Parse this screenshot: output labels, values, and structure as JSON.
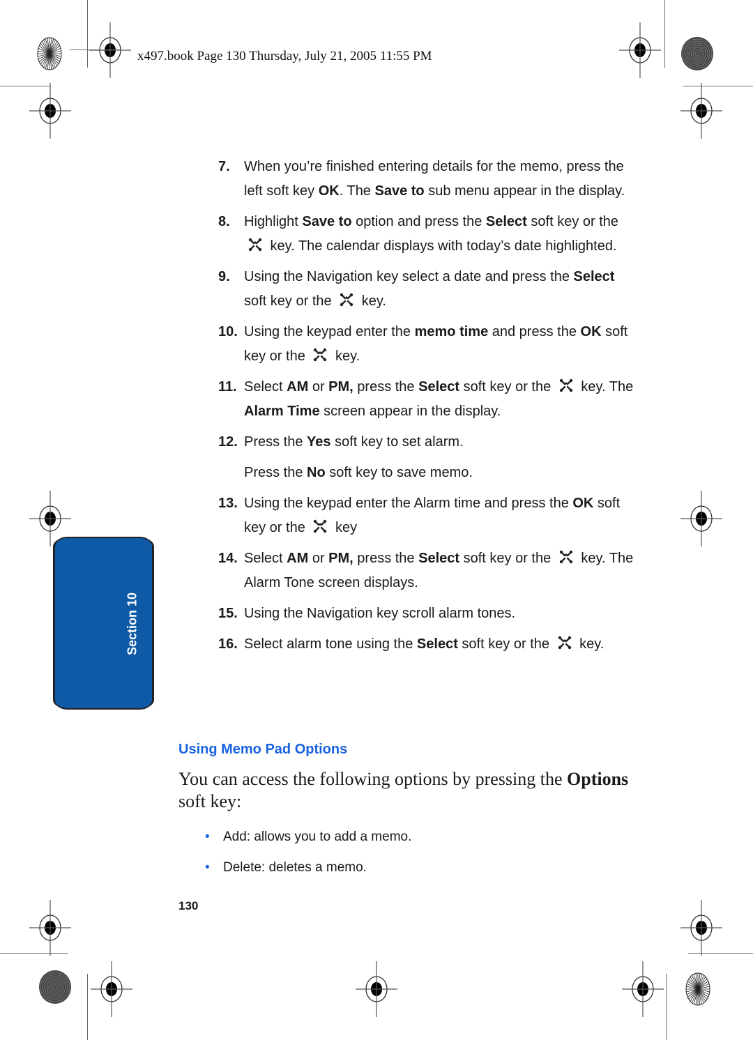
{
  "header": {
    "text": "x497.book  Page 130  Thursday, July 21, 2005  11:55 PM"
  },
  "section_tab": {
    "label": "Section 10",
    "color": "#0e5aa7"
  },
  "steps": [
    {
      "num": "7.",
      "parts": [
        {
          "t": "When you’re finished entering details for the memo, press the left soft key "
        },
        {
          "t": "OK",
          "b": true
        },
        {
          "t": ". The "
        },
        {
          "t": "Save to",
          "b": true
        },
        {
          "t": " sub menu appear in the display."
        }
      ]
    },
    {
      "num": "8.",
      "parts": [
        {
          "t": "Highlight "
        },
        {
          "t": "Save to",
          "b": true
        },
        {
          "t": " option and press the "
        },
        {
          "t": "Select",
          "b": true
        },
        {
          "t": " soft key or the "
        },
        {
          "icon": "nav-key"
        },
        {
          "t": " key. The calendar displays with today’s date highlighted."
        }
      ]
    },
    {
      "num": "9.",
      "parts": [
        {
          "t": "Using the Navigation key select a date and press the "
        },
        {
          "t": "Select",
          "b": true
        },
        {
          "t": " soft key or the "
        },
        {
          "icon": "nav-key"
        },
        {
          "t": " key."
        }
      ]
    },
    {
      "num": "10.",
      "parts": [
        {
          "t": "Using the keypad enter the "
        },
        {
          "t": "memo time",
          "b": true
        },
        {
          "t": " and press the "
        },
        {
          "t": "OK",
          "b": true
        },
        {
          "t": " soft key or the "
        },
        {
          "icon": "nav-key"
        },
        {
          "t": " key."
        }
      ]
    },
    {
      "num": "11.",
      "parts": [
        {
          "t": "Select "
        },
        {
          "t": "AM",
          "b": true
        },
        {
          "t": " or "
        },
        {
          "t": "PM,",
          "b": true
        },
        {
          "t": " press the "
        },
        {
          "t": "Select",
          "b": true
        },
        {
          "t": " soft key or the "
        },
        {
          "icon": "nav-key"
        },
        {
          "t": " key. The "
        },
        {
          "t": "Alarm Time",
          "b": true
        },
        {
          "t": " screen appear in the display."
        }
      ]
    },
    {
      "num": "12.",
      "parts": [
        {
          "t": "Press the "
        },
        {
          "t": "Yes",
          "b": true
        },
        {
          "t": " soft key to set alarm."
        }
      ],
      "sub": [
        {
          "t": "Press the "
        },
        {
          "t": "No",
          "b": true
        },
        {
          "t": " soft key to save memo."
        }
      ]
    },
    {
      "num": "13.",
      "parts": [
        {
          "t": " Using the keypad enter the Alarm time and press the "
        },
        {
          "t": "OK",
          "b": true
        },
        {
          "t": " soft key or the "
        },
        {
          "icon": "nav-key"
        },
        {
          "t": " key"
        }
      ]
    },
    {
      "num": "14.",
      "parts": [
        {
          "t": "Select "
        },
        {
          "t": "AM",
          "b": true
        },
        {
          "t": " or "
        },
        {
          "t": "PM,",
          "b": true
        },
        {
          "t": " press the "
        },
        {
          "t": "Select",
          "b": true
        },
        {
          "t": " soft key or the "
        },
        {
          "icon": "nav-key"
        },
        {
          "t": " key. The Alarm Tone screen displays."
        }
      ]
    },
    {
      "num": "15.",
      "parts": [
        {
          "t": "Using the Navigation key scroll alarm tones."
        }
      ]
    },
    {
      "num": "16.",
      "parts": [
        {
          "t": "Select alarm tone using the "
        },
        {
          "t": "Select",
          "b": true
        },
        {
          "t": " soft key or the "
        },
        {
          "icon": "nav-key"
        },
        {
          "t": " key."
        }
      ]
    }
  ],
  "subheading": "Using Memo Pad Options",
  "subheading_color": "#1a63e0",
  "intro": {
    "before": "You can access the following options by pressing the ",
    "bold": "Options",
    "after": " soft key:"
  },
  "bullets": [
    {
      "dot": "•",
      "text": "Add: allows you to add a memo."
    },
    {
      "dot": "•",
      "text": "Delete: deletes a memo."
    }
  ],
  "page_number": "130"
}
